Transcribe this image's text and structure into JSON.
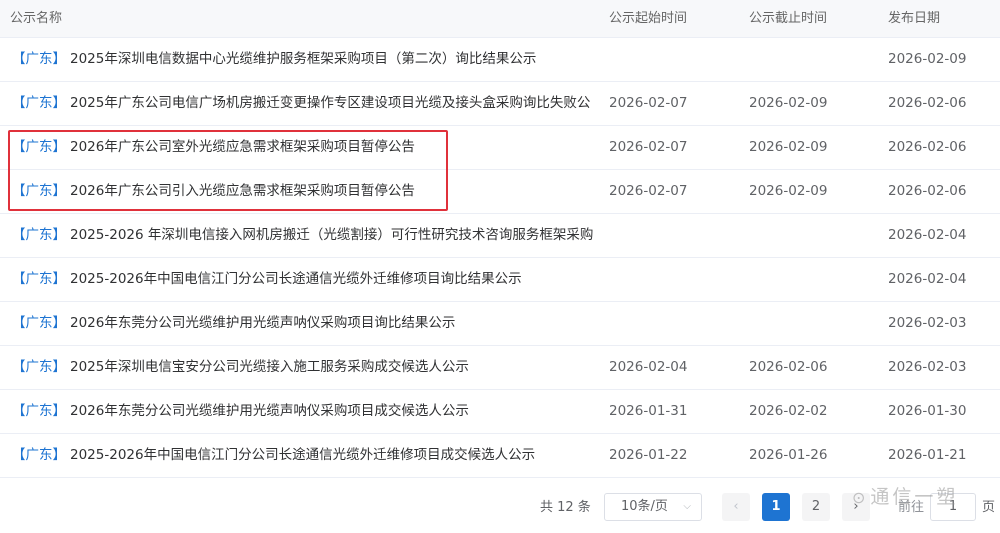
{
  "table": {
    "headers": {
      "name": "公示名称",
      "start": "公示起始时间",
      "end": "公示截止时间",
      "published": "发布日期"
    },
    "rows": [
      {
        "region": "【广东】",
        "title": "2025年深圳电信数据中心光缆维护服务框架采购项目（第二次）询比结果公示",
        "start": "",
        "end": "",
        "published": "2026-02-09"
      },
      {
        "region": "【广东】",
        "title": "2025年广东公司电信广场机房搬迁变更操作专区建设项目光缆及接头盒采购询比失败公",
        "start": "2026-02-07",
        "end": "2026-02-09",
        "published": "2026-02-06"
      },
      {
        "region": "【广东】",
        "title": "2026年广东公司室外光缆应急需求框架采购项目暂停公告",
        "start": "2026-02-07",
        "end": "2026-02-09",
        "published": "2026-02-06"
      },
      {
        "region": "【广东】",
        "title": "2026年广东公司引入光缆应急需求框架采购项目暂停公告",
        "start": "2026-02-07",
        "end": "2026-02-09",
        "published": "2026-02-06"
      },
      {
        "region": "【广东】",
        "title": "2025-2026 年深圳电信接入网机房搬迁（光缆割接）可行性研究技术咨询服务框架采购",
        "start": "",
        "end": "",
        "published": "2026-02-04"
      },
      {
        "region": "【广东】",
        "title": "2025-2026年中国电信江门分公司长途通信光缆外迁维修项目询比结果公示",
        "start": "",
        "end": "",
        "published": "2026-02-04"
      },
      {
        "region": "【广东】",
        "title": "2026年东莞分公司光缆维护用光缆声呐仪采购项目询比结果公示",
        "start": "",
        "end": "",
        "published": "2026-02-03"
      },
      {
        "region": "【广东】",
        "title": "2025年深圳电信宝安分公司光缆接入施工服务采购成交候选人公示",
        "start": "2026-02-04",
        "end": "2026-02-06",
        "published": "2026-02-03"
      },
      {
        "region": "【广东】",
        "title": "2026年东莞分公司光缆维护用光缆声呐仪采购项目成交候选人公示",
        "start": "2026-01-31",
        "end": "2026-02-02",
        "published": "2026-01-30"
      },
      {
        "region": "【广东】",
        "title": "2025-2026年中国电信江门分公司长途通信光缆外迁维修项目成交候选人公示",
        "start": "2026-01-22",
        "end": "2026-01-26",
        "published": "2026-01-21"
      }
    ]
  },
  "pagination": {
    "total_text": "共 12 条",
    "page_size": "10条/页",
    "prev_icon": "chevron-left",
    "pages": [
      "1",
      "2"
    ],
    "current_page": "1",
    "next_icon": "chevron-right",
    "goto_label": "前往",
    "goto_value": "1",
    "page_unit": "页"
  },
  "watermark": {
    "logo": "⊙",
    "text": "通信一塑"
  },
  "colors": {
    "accent": "#1e74d2",
    "highlight_border": "#e0313b",
    "header_bg": "#f7f8fa"
  }
}
